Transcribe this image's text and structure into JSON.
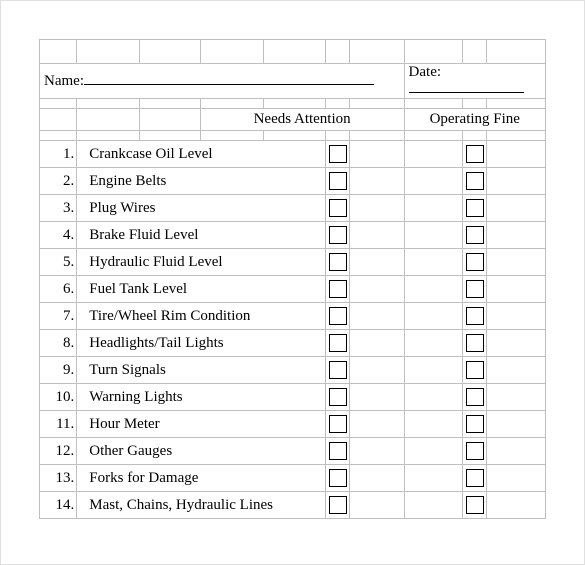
{
  "form": {
    "name_label": "Name:",
    "name_value": "",
    "date_label": "Date:",
    "date_value": ""
  },
  "columns": {
    "needs_attention": "Needs Attention",
    "operating_fine": "Operating Fine"
  },
  "items": [
    {
      "num": "1.",
      "label": "Crankcase Oil Level"
    },
    {
      "num": "2.",
      "label": "Engine Belts"
    },
    {
      "num": "3.",
      "label": "Plug Wires"
    },
    {
      "num": "4.",
      "label": "Brake Fluid Level"
    },
    {
      "num": "5.",
      "label": "Hydraulic Fluid Level"
    },
    {
      "num": "6.",
      "label": "Fuel Tank Level"
    },
    {
      "num": "7.",
      "label": "Tire/Wheel Rim Condition"
    },
    {
      "num": "8.",
      "label": "Headlights/Tail Lights"
    },
    {
      "num": "9.",
      "label": "Turn Signals"
    },
    {
      "num": "10.",
      "label": "Warning Lights"
    },
    {
      "num": "11.",
      "label": "Hour Meter"
    },
    {
      "num": "12.",
      "label": "Other Gauges"
    },
    {
      "num": "13.",
      "label": "Forks for Damage"
    },
    {
      "num": "14.",
      "label": "Mast, Chains, Hydraulic Lines"
    }
  ]
}
